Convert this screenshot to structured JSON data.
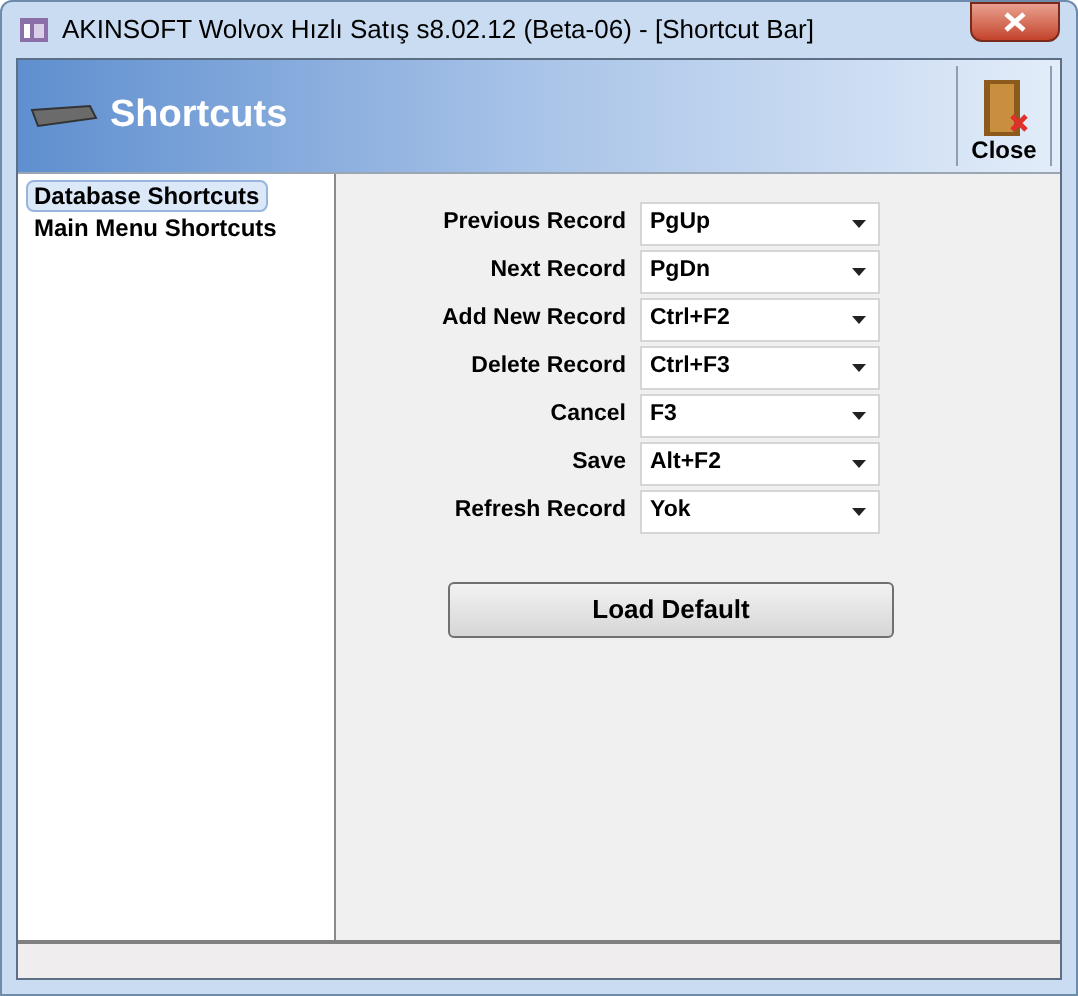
{
  "window": {
    "title": "AKINSOFT Wolvox Hızlı Satış s8.02.12 (Beta-06) - [Shortcut Bar]"
  },
  "header": {
    "title": "Shortcuts",
    "close_label": "Close"
  },
  "sidebar": {
    "items": [
      {
        "label": "Database Shortcuts",
        "selected": true
      },
      {
        "label": "Main Menu Shortcuts",
        "selected": false
      }
    ]
  },
  "shortcuts": [
    {
      "label": "Previous Record",
      "value": "PgUp"
    },
    {
      "label": "Next Record",
      "value": "PgDn"
    },
    {
      "label": "Add New Record",
      "value": "Ctrl+F2"
    },
    {
      "label": "Delete Record",
      "value": "Ctrl+F3"
    },
    {
      "label": "Cancel",
      "value": "F3"
    },
    {
      "label": "Save",
      "value": "Alt+F2"
    },
    {
      "label": "Refresh Record",
      "value": "Yok"
    }
  ],
  "load_default_button": "Load Default"
}
